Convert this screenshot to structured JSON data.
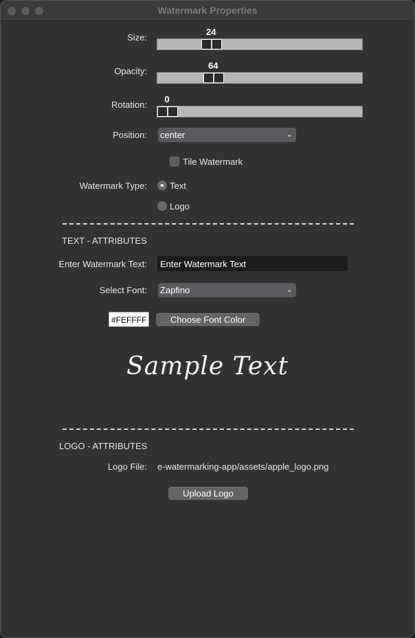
{
  "window": {
    "title": "Watermark Properties"
  },
  "size": {
    "label": "Size:",
    "value": "24",
    "min": 0,
    "max": 100
  },
  "opacity": {
    "label": "Opacity:",
    "value": "64",
    "min": 0,
    "max": 255
  },
  "rotation": {
    "label": "Rotation:",
    "value": "0",
    "min": 0,
    "max": 360
  },
  "position": {
    "label": "Position:",
    "selected": "center"
  },
  "tile": {
    "label": "Tile Watermark",
    "checked": false
  },
  "watermark_type": {
    "label": "Watermark Type:",
    "options": [
      "Text",
      "Logo"
    ],
    "selected": "Text"
  },
  "divider_text": "------------------------------------------------------------------------",
  "text_attributes": {
    "heading": "TEXT - ATTRIBUTES",
    "input_label": "Enter Watermark Text:",
    "input_value": "Enter Watermark Text",
    "font_label": "Select Font:",
    "font_selected": "Zapfino",
    "color_value": "#FEFFFF",
    "color_button": "Choose Font Color",
    "sample_text": "Sample Text"
  },
  "logo_attributes": {
    "heading": "LOGO - ATTRIBUTES",
    "file_label": "Logo File:",
    "file_path": "e-watermarking-app/assets/apple_logo.png",
    "upload_button": "Upload Logo"
  },
  "icons": {
    "chevron": "chevron-down-icon"
  }
}
